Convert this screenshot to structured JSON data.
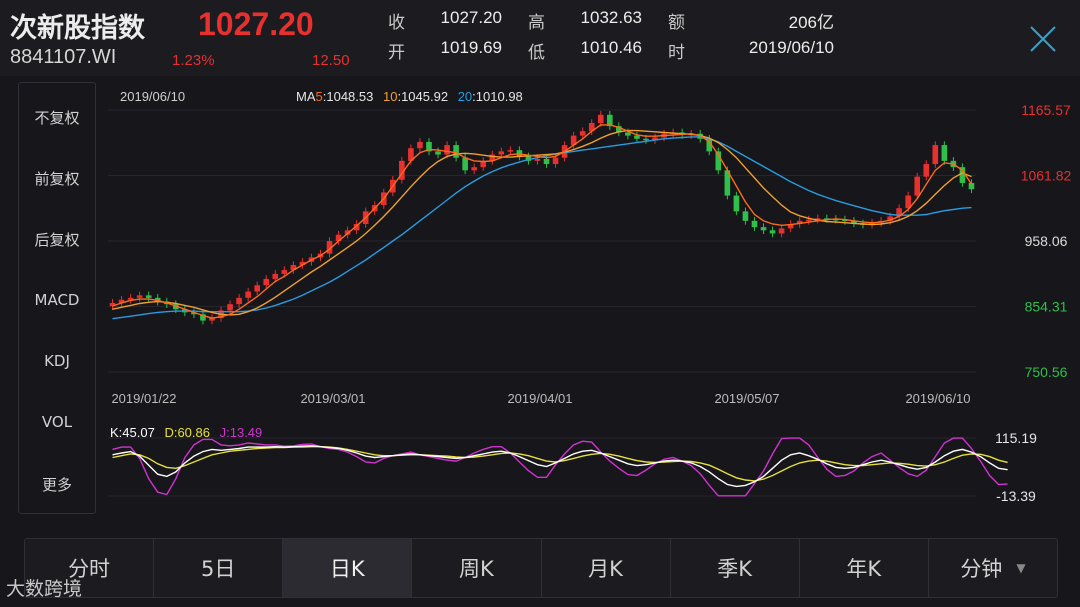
{
  "header": {
    "name": "次新股指数",
    "code": "8841107.WI",
    "price": "1027.20",
    "change_pct": "1.23%",
    "change_abs": "12.50",
    "quotes": [
      {
        "label": "收",
        "value": "1027.20"
      },
      {
        "label": "高",
        "value": "1032.63"
      },
      {
        "label": "额",
        "value": "206亿"
      },
      {
        "label": "开",
        "value": "1019.69"
      },
      {
        "label": "低",
        "value": "1010.46"
      },
      {
        "label": "时",
        "value": "2019/06/10"
      }
    ]
  },
  "sidebar": {
    "items": [
      {
        "label": "不复权",
        "active": true
      },
      {
        "label": "前复权",
        "active": false
      },
      {
        "label": "后复权",
        "active": false
      },
      {
        "label": "MACD",
        "active": false
      },
      {
        "label": "KDJ",
        "active": true
      },
      {
        "label": "VOL",
        "active": false
      },
      {
        "label": "更多",
        "active": false
      }
    ]
  },
  "tabs": [
    {
      "label": "分时",
      "active": false
    },
    {
      "label": "5日",
      "active": false
    },
    {
      "label": "日K",
      "active": true
    },
    {
      "label": "周K",
      "active": false
    },
    {
      "label": "月K",
      "active": false
    },
    {
      "label": "季K",
      "active": false
    },
    {
      "label": "年K",
      "active": false
    },
    {
      "label": "分钟",
      "active": false,
      "dropdown": true
    }
  ],
  "watermark": "大数跨境",
  "colors": {
    "up": "#e8302f",
    "down": "#2fbf4a",
    "ma5": "#ff6a1a",
    "ma10": "#f0a030",
    "ma20": "#2a9be0",
    "k": "#ffffff",
    "d": "#e6e03a",
    "j": "#d033d0"
  },
  "chart_data": {
    "type": "candlestick",
    "date_label": "2019/06/10",
    "ma_legend": [
      {
        "prefix": "MA",
        "period": "5",
        "value": "1048.53"
      },
      {
        "period": "10",
        "value": "1045.92"
      },
      {
        "period": "20",
        "value": "1010.98"
      }
    ],
    "price_ticks": [
      "1165.57",
      "1061.82",
      "958.06",
      "854.31",
      "750.56"
    ],
    "price_ylim": [
      750.56,
      1165.57
    ],
    "x_labels": [
      "2019/01/22",
      "2019/03/01",
      "2019/04/01",
      "2019/05/07",
      "2019/06/10"
    ],
    "closes": [
      860,
      865,
      868,
      872,
      868,
      862,
      858,
      850,
      845,
      842,
      832,
      836,
      848,
      858,
      868,
      878,
      888,
      898,
      906,
      912,
      920,
      925,
      932,
      938,
      958,
      968,
      975,
      985,
      1005,
      1015,
      1035,
      1055,
      1085,
      1105,
      1115,
      1100,
      1095,
      1110,
      1090,
      1070,
      1075,
      1085,
      1095,
      1100,
      1102,
      1092,
      1085,
      1088,
      1080,
      1090,
      1110,
      1125,
      1132,
      1145,
      1158,
      1140,
      1130,
      1125,
      1120,
      1118,
      1122,
      1128,
      1130,
      1126,
      1128,
      1120,
      1100,
      1070,
      1030,
      1005,
      990,
      980,
      975,
      970,
      978,
      985,
      990,
      992,
      994,
      993,
      992,
      990,
      986,
      984,
      987,
      990,
      997,
      1010,
      1030,
      1060,
      1080,
      1110,
      1085,
      1075,
      1050,
      1040
    ],
    "ma5": [
      855,
      860,
      864,
      866,
      866,
      864,
      860,
      855,
      850,
      845,
      840,
      836,
      838,
      842,
      850,
      860,
      870,
      882,
      894,
      902,
      912,
      920,
      928,
      935,
      945,
      958,
      970,
      982,
      995,
      1010,
      1025,
      1045,
      1065,
      1085,
      1098,
      1103,
      1102,
      1100,
      1098,
      1090,
      1085,
      1084,
      1085,
      1090,
      1095,
      1096,
      1094,
      1092,
      1090,
      1092,
      1100,
      1110,
      1120,
      1132,
      1142,
      1142,
      1138,
      1132,
      1126,
      1124,
      1124,
      1125,
      1126,
      1127,
      1128,
      1125,
      1115,
      1095,
      1070,
      1045,
      1020,
      1000,
      990,
      985,
      983,
      984,
      986,
      988,
      990,
      992,
      993,
      992,
      990,
      988,
      987,
      988,
      991,
      997,
      1008,
      1025,
      1048,
      1070,
      1082,
      1080,
      1070,
      1048
    ],
    "ma10": [
      850,
      853,
      856,
      859,
      861,
      862,
      861,
      859,
      856,
      853,
      849,
      845,
      842,
      841,
      842,
      846,
      852,
      860,
      869,
      879,
      889,
      899,
      909,
      918,
      928,
      938,
      948,
      958,
      970,
      983,
      997,
      1012,
      1028,
      1044,
      1059,
      1073,
      1084,
      1092,
      1096,
      1097,
      1096,
      1094,
      1092,
      1091,
      1091,
      1092,
      1093,
      1094,
      1095,
      1096,
      1099,
      1103,
      1108,
      1114,
      1121,
      1127,
      1131,
      1133,
      1133,
      1132,
      1131,
      1130,
      1129,
      1128,
      1127,
      1125,
      1121,
      1114,
      1103,
      1090,
      1074,
      1058,
      1042,
      1028,
      1015,
      1004,
      998,
      994,
      991,
      989,
      988,
      987,
      986,
      985,
      984,
      985,
      987,
      991,
      997,
      1006,
      1018,
      1032,
      1046,
      1058,
      1066,
      1060
    ],
    "ma20": [
      835,
      837,
      839,
      841,
      843,
      845,
      846,
      847,
      847,
      847,
      846,
      846,
      846,
      846,
      846,
      847,
      849,
      852,
      856,
      861,
      866,
      872,
      879,
      886,
      893,
      901,
      910,
      919,
      928,
      938,
      948,
      958,
      968,
      979,
      990,
      1001,
      1012,
      1023,
      1034,
      1044,
      1053,
      1061,
      1068,
      1074,
      1079,
      1083,
      1087,
      1090,
      1093,
      1096,
      1098,
      1100,
      1102,
      1104,
      1106,
      1108,
      1110,
      1112,
      1114,
      1116,
      1118,
      1120,
      1121,
      1122,
      1123,
      1123,
      1120,
      1115,
      1108,
      1100,
      1092,
      1084,
      1076,
      1068,
      1060,
      1052,
      1045,
      1038,
      1032,
      1027,
      1022,
      1018,
      1014,
      1010,
      1006,
      1003,
      1000,
      999,
      999,
      999,
      1000,
      1003,
      1006,
      1008,
      1010,
      1011
    ],
    "kdj_ticks": [
      "115.19",
      "-13.39"
    ],
    "kdj_ylim": [
      -13.39,
      115.19
    ],
    "kdj_legend": {
      "k": "K:45.07",
      "d": "D:60.86",
      "j": "J:13.49"
    },
    "k": [
      78,
      82,
      85,
      75,
      55,
      35,
      30,
      40,
      60,
      75,
      85,
      90,
      88,
      90,
      92,
      95,
      95,
      95,
      96,
      95,
      96,
      97,
      98,
      96,
      94,
      92,
      88,
      82,
      75,
      72,
      74,
      76,
      78,
      80,
      78,
      76,
      74,
      72,
      70,
      72,
      76,
      80,
      84,
      86,
      82,
      74,
      65,
      56,
      52,
      60,
      70,
      80,
      86,
      88,
      82,
      74,
      66,
      58,
      54,
      56,
      60,
      64,
      66,
      64,
      60,
      52,
      40,
      25,
      12,
      8,
      10,
      18,
      30,
      48,
      66,
      78,
      82,
      76,
      68,
      58,
      50,
      48,
      50,
      56,
      62,
      66,
      62,
      56,
      50,
      46,
      50,
      62,
      76,
      86,
      90,
      84,
      74,
      60,
      48,
      45
    ],
    "d": [
      72,
      76,
      80,
      78,
      70,
      58,
      50,
      48,
      54,
      62,
      70,
      78,
      82,
      86,
      88,
      90,
      92,
      93,
      94,
      94,
      95,
      95,
      96,
      96,
      95,
      93,
      90,
      86,
      82,
      78,
      76,
      76,
      77,
      78,
      78,
      77,
      76,
      75,
      73,
      72,
      73,
      75,
      78,
      81,
      82,
      80,
      76,
      70,
      64,
      62,
      65,
      70,
      75,
      79,
      81,
      79,
      75,
      70,
      65,
      62,
      61,
      62,
      63,
      64,
      63,
      60,
      55,
      46,
      36,
      27,
      22,
      20,
      24,
      32,
      42,
      52,
      60,
      64,
      66,
      64,
      60,
      56,
      54,
      54,
      56,
      58,
      60,
      59,
      57,
      54,
      53,
      56,
      62,
      70,
      77,
      80,
      79,
      74,
      66,
      61
    ],
    "j": [
      90,
      95,
      95,
      70,
      25,
      -5,
      -10,
      25,
      72,
      100,
      112,
      112,
      100,
      98,
      100,
      104,
      102,
      100,
      100,
      97,
      98,
      101,
      102,
      96,
      92,
      90,
      84,
      74,
      62,
      60,
      70,
      76,
      80,
      84,
      78,
      74,
      70,
      66,
      64,
      72,
      82,
      90,
      96,
      96,
      82,
      62,
      43,
      28,
      28,
      56,
      80,
      100,
      108,
      106,
      84,
      64,
      48,
      34,
      32,
      44,
      58,
      68,
      72,
      64,
      54,
      36,
      10,
      -13,
      -13,
      -13,
      -13,
      14,
      42,
      80,
      114,
      115,
      115,
      100,
      72,
      46,
      30,
      32,
      42,
      60,
      74,
      82,
      66,
      50,
      36,
      30,
      44,
      74,
      104,
      115,
      115,
      92,
      64,
      32,
      12,
      13
    ]
  }
}
